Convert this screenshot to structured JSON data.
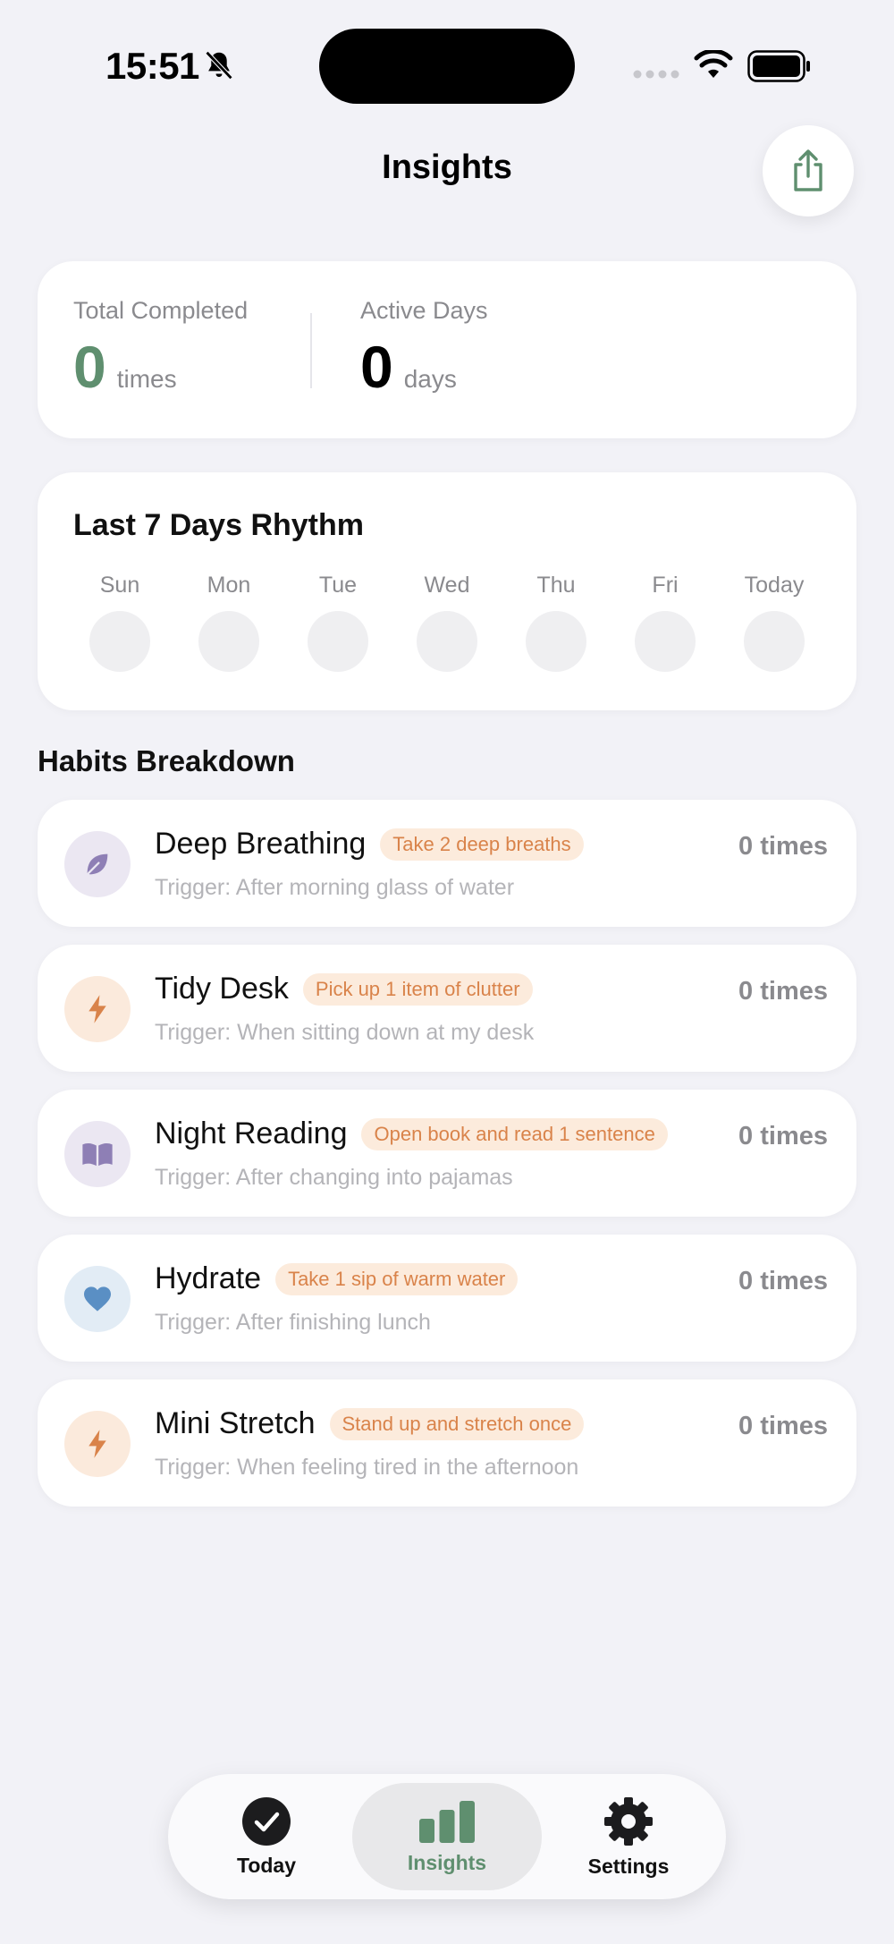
{
  "status_bar": {
    "time": "15:51"
  },
  "header": {
    "title": "Insights"
  },
  "stats": {
    "total_completed": {
      "label": "Total Completed",
      "value": "0",
      "unit": "times"
    },
    "active_days": {
      "label": "Active Days",
      "value": "0",
      "unit": "days"
    }
  },
  "rhythm": {
    "title": "Last 7 Days Rhythm",
    "days": [
      "Sun",
      "Mon",
      "Tue",
      "Wed",
      "Thu",
      "Fri",
      "Today"
    ]
  },
  "breakdown": {
    "title": "Habits Breakdown",
    "habits": [
      {
        "name": "Deep Breathing",
        "tag": "Take 2 deep breaths",
        "trigger": "Trigger: After morning glass of water",
        "count": "0 times",
        "icon": "leaf-icon"
      },
      {
        "name": "Tidy Desk",
        "tag": "Pick up 1 item of clutter",
        "trigger": "Trigger: When sitting down at my desk",
        "count": "0 times",
        "icon": "bolt-icon"
      },
      {
        "name": "Night Reading",
        "tag": "Open book and read 1 sentence",
        "trigger": "Trigger: After changing into pajamas",
        "count": "0 times",
        "icon": "book-icon"
      },
      {
        "name": "Hydrate",
        "tag": "Take 1 sip of warm water",
        "trigger": "Trigger: After finishing lunch",
        "count": "0 times",
        "icon": "heart-icon"
      },
      {
        "name": "Mini Stretch",
        "tag": "Stand up and stretch once",
        "trigger": "Trigger: When feeling tired in the afternoon",
        "count": "0 times",
        "icon": "bolt-icon"
      }
    ]
  },
  "tab_bar": {
    "today": "Today",
    "insights": "Insights",
    "settings": "Settings"
  },
  "colors": {
    "accent_green": "#5f8f6f",
    "tag_orange": "#d9834a",
    "tag_bg": "#fcebdc",
    "purple": "#8e7fb5",
    "blue": "#5a8fc4"
  }
}
